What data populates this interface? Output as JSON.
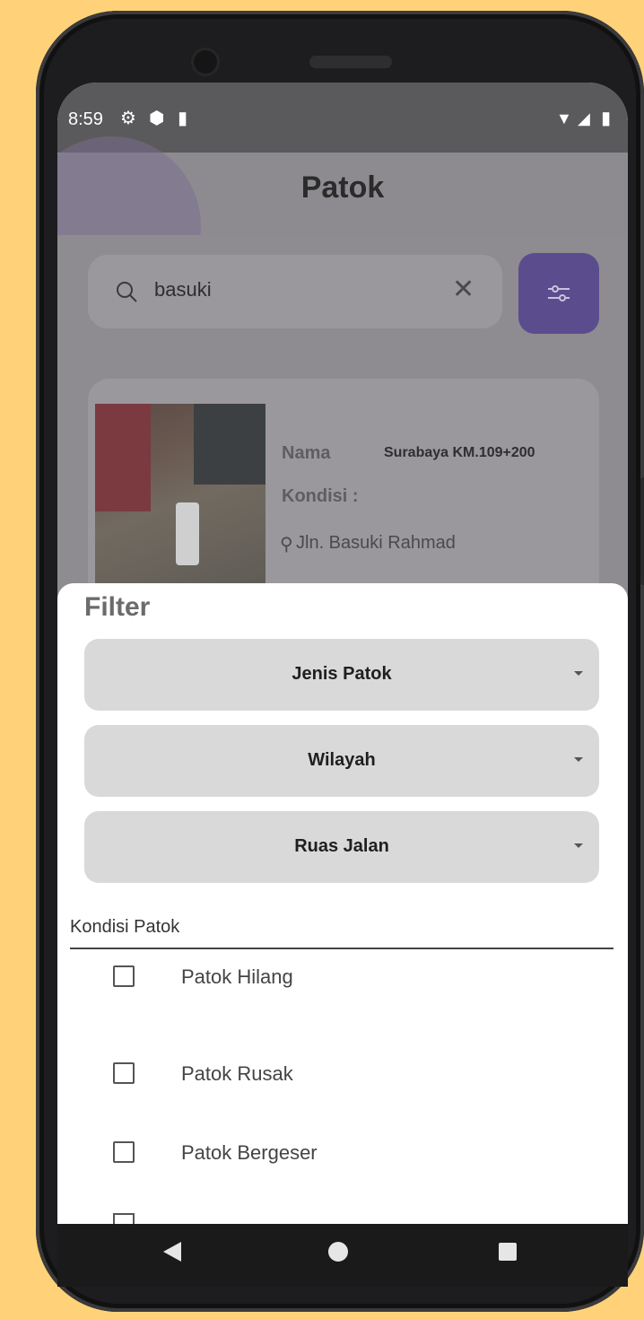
{
  "status_bar": {
    "time": "8:59"
  },
  "app_bar": {
    "title": "Patok"
  },
  "search": {
    "value": "basuki"
  },
  "card": {
    "name_label": "Nama",
    "name_value": "Surabaya KM.109+200",
    "condition_label": "Kondisi :",
    "location": "Jln. Basuki Rahmad"
  },
  "filter_sheet": {
    "title": "Filter",
    "dropdowns": [
      {
        "label": "Jenis Patok"
      },
      {
        "label": "Wilayah"
      },
      {
        "label": "Ruas Jalan"
      }
    ],
    "condition_section": "Kondisi Patok",
    "conditions": [
      {
        "label": "Patok Hilang",
        "checked": false
      },
      {
        "label": "Patok Rusak",
        "checked": false
      },
      {
        "label": "Patok Bergeser",
        "checked": false
      }
    ]
  },
  "icons": {
    "search": "search-icon",
    "clear": "close-icon",
    "filter": "sliders-icon",
    "location": "location-pin-icon",
    "dropdown": "caret-down-icon"
  },
  "colors": {
    "background": "#FFD27A",
    "accent": "#5b4d8d",
    "dropdown_bg": "#d9d9d9"
  }
}
